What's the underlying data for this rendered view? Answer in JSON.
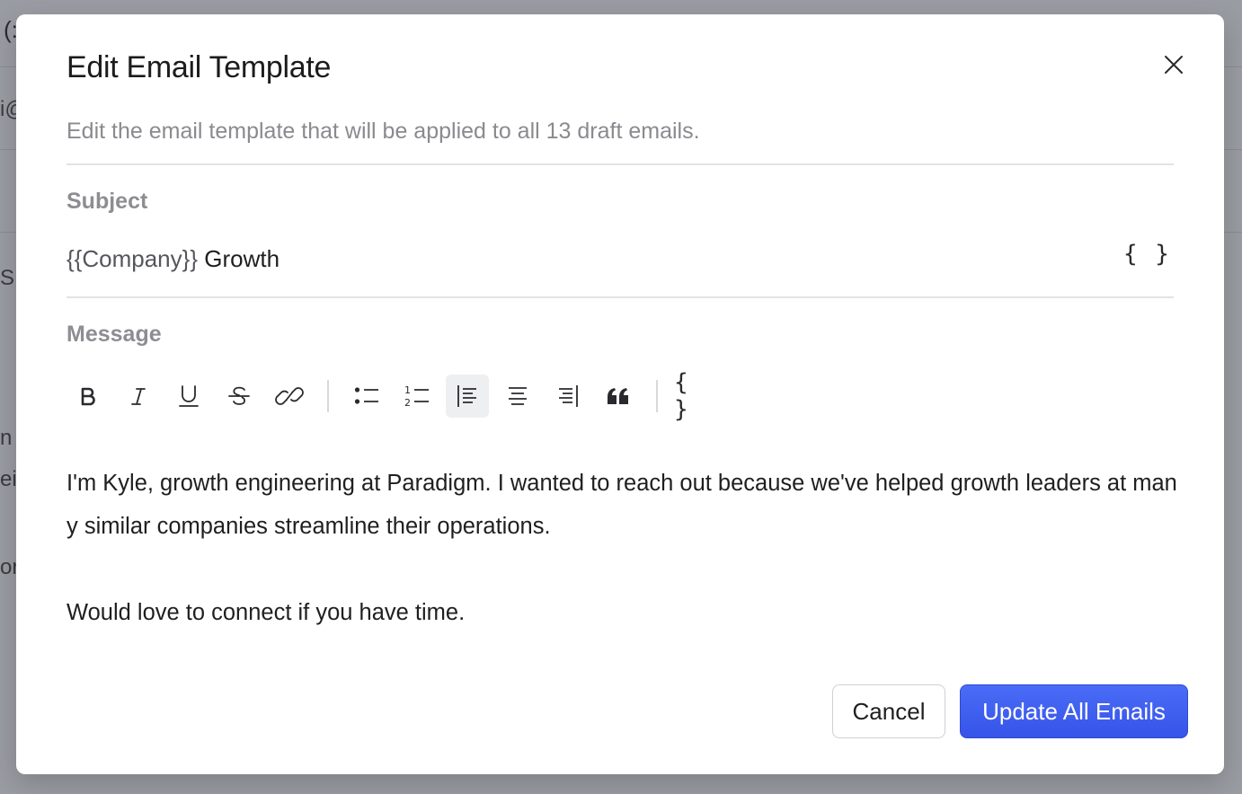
{
  "background": {
    "fragments": [
      "(:",
      "i@",
      "S",
      "n",
      "ei",
      "or"
    ]
  },
  "modal": {
    "title": "Edit Email Template",
    "subtitle": "Edit the email template that will be applied to all 13 draft emails.",
    "subject": {
      "label": "Subject",
      "variable_part": "{{Company}}",
      "text_part": " Growth",
      "insert_variable_label": "{ }"
    },
    "message": {
      "label": "Message",
      "toolbar": [
        {
          "name": "bold-icon",
          "active": false
        },
        {
          "name": "italic-icon",
          "active": false
        },
        {
          "name": "underline-icon",
          "active": false
        },
        {
          "name": "strikethrough-icon",
          "active": false
        },
        {
          "name": "link-icon",
          "active": false
        },
        {
          "name": "bullet-list-icon",
          "active": false
        },
        {
          "name": "numbered-list-icon",
          "active": false
        },
        {
          "name": "align-left-icon",
          "active": true
        },
        {
          "name": "align-center-icon",
          "active": false
        },
        {
          "name": "align-right-icon",
          "active": false
        },
        {
          "name": "blockquote-icon",
          "active": false
        },
        {
          "name": "insert-variable-icon",
          "active": false
        }
      ],
      "insert_variable_label": "{ }",
      "paragraphs": [
        "I'm Kyle, growth engineering at Paradigm. I wanted to reach out because we've helped growth leaders at many similar companies streamline their operations.",
        "Would love to connect if you have time."
      ]
    },
    "buttons": {
      "cancel": "Cancel",
      "update": "Update All Emails"
    },
    "colors": {
      "primary": "#3f5ff0",
      "overlay": "#9a9ca3"
    }
  }
}
